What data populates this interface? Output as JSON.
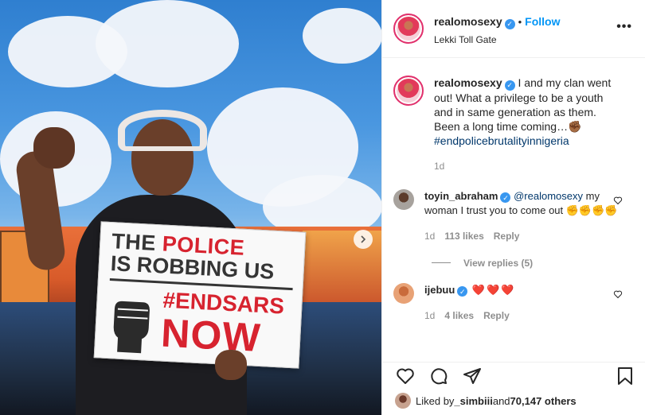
{
  "post": {
    "author": {
      "username": "realomosexy",
      "verified_icon": "verified-badge-icon",
      "separator": "•",
      "follow_label": "Follow",
      "location": "Lekki Toll Gate",
      "more_label": "•••"
    },
    "photo": {
      "sign": {
        "line1_a": "THE ",
        "line1_b": "POLICE",
        "line2": "IS ROBBING US",
        "hashtag": "#ENDSARS",
        "now": "NOW"
      },
      "next_icon": "chevron-right-icon"
    },
    "caption": {
      "username": "realomosexy",
      "text": " I and my clan went out! What a privilege to be a youth and in same generation as them. Been a long time coming…✊🏾 ",
      "hashtag": "#endpolicebrutalityinnigeria",
      "time": "1d"
    },
    "comments": [
      {
        "username": "toyin_abraham",
        "mention": "@realomosexy",
        "text": " my woman I trust you to come out ✊✊✊✊",
        "time": "1d",
        "likes": "113 likes",
        "reply_label": "Reply",
        "view_replies": "View replies (5)"
      },
      {
        "username": "ijebuu",
        "text": " ❤️❤️❤️",
        "time": "1d",
        "likes": "4 likes",
        "reply_label": "Reply"
      }
    ],
    "actions": [
      "heart-icon",
      "comment-icon",
      "share-icon",
      "bookmark-icon"
    ],
    "liked_by": {
      "prefix": "Liked by ",
      "user": "_simbiii",
      "middle": " and ",
      "count": "70,147 others"
    },
    "colors": {
      "follow_blue": "#0095f6",
      "verified_blue": "#3897f0",
      "hashtag_navy": "#00376b",
      "meta_gray": "#8e8e8e",
      "sign_red": "#d7232f"
    }
  }
}
